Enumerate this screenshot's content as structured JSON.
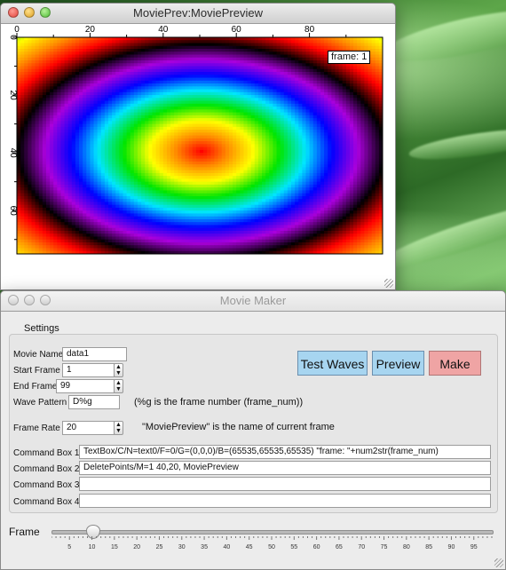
{
  "preview_window": {
    "title": "MoviePrev:MoviePreview",
    "frame_label": "frame: 1",
    "x_axis_ticks": [
      "0",
      "20",
      "40",
      "60",
      "80"
    ],
    "y_axis_ticks": [
      "0",
      "20",
      "40",
      "60"
    ]
  },
  "maker_window": {
    "title": "Movie Maker",
    "tab_label": "Settings",
    "movie_name": {
      "label": "Movie Name",
      "value": "data1"
    },
    "start_frame": {
      "label": "Start Frame",
      "value": "1"
    },
    "end_frame": {
      "label": "End Frame",
      "value": "99"
    },
    "wave_pattern": {
      "label": "Wave Pattern",
      "value": "D%g",
      "note": "(%g is the frame number (frame_num))"
    },
    "frame_rate": {
      "label": "Frame Rate",
      "value": "20",
      "note": "\"MoviePreview\" is the name of current frame"
    },
    "buttons": {
      "test_waves": "Test Waves",
      "preview": "Preview",
      "make": "Make"
    },
    "command_boxes": [
      {
        "label": "Command Box 1",
        "value": "TextBox/C/N=text0/F=0/G=(0,0,0)/B=(65535,65535,65535) \"frame: \"+num2str(frame_num)"
      },
      {
        "label": "Command Box 2",
        "value": "DeletePoints/M=1 40,20, MoviePreview"
      },
      {
        "label": "Command Box 3",
        "value": ""
      },
      {
        "label": "Command Box 4",
        "value": ""
      }
    ],
    "slider": {
      "label": "Frame",
      "value": 10,
      "min": 1,
      "max": 99,
      "tick_labels": [
        "5",
        "10",
        "15",
        "20",
        "25",
        "30",
        "35",
        "40",
        "45",
        "50",
        "55",
        "60",
        "65",
        "70",
        "75",
        "80",
        "85",
        "90",
        "95"
      ]
    }
  },
  "colors": {
    "button_blue": "#a7d5f0",
    "button_red": "#efa4a4"
  }
}
